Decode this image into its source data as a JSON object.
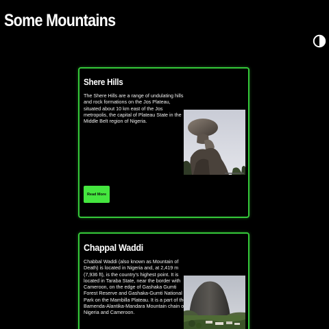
{
  "header": {
    "title": "Some Mountains",
    "theme_toggle_icon": "half-circle-contrast-icon"
  },
  "cards": [
    {
      "title": "Shere Hills",
      "description": "The Shere Hills are a range of undulating hills and rock formations on the Jos Plateau, situated about 10 km east of the Jos metropolis, the capital of Plateau State in the Middle Belt region of Nigeria.",
      "image": "balancing-rock-photo",
      "button_label": "Read More"
    },
    {
      "title": "Chappal Waddi",
      "description": "Chabbal Waddi (also known as Mountain of Death) is located in Nigeria and, at 2,419 m (7,936 ft), is the country's highest point. It is located in Taraba State, near the border with Cameroon, on the edge of Gashaka Gumti Forest Reserve and Gashaka-Gumti National Park on the Mambilla Plateau. It is a part of the Bamenda-Alantika-Mandara Mountain chain of Nigeria and Cameroon.",
      "image": "dome-mountain-photo"
    }
  ],
  "colors": {
    "background": "#000000",
    "accent": "#35c93a",
    "button": "#45e63f",
    "text": "#ffffff"
  }
}
